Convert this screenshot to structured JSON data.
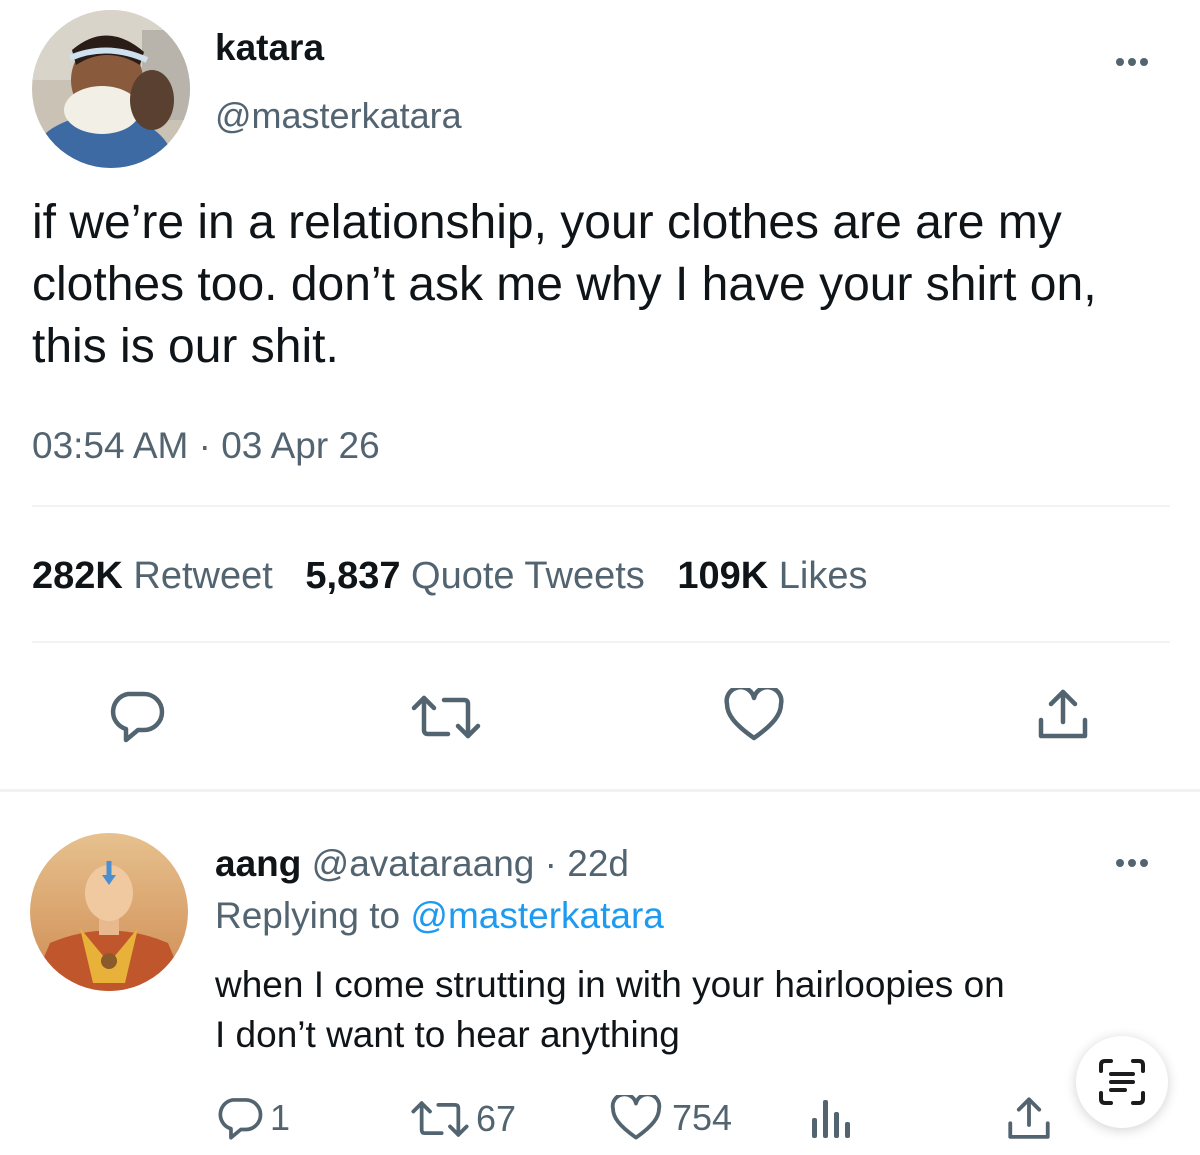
{
  "tweet": {
    "author": {
      "display_name": "katara",
      "handle": "@masterkatara",
      "avatar_icon": "katara-avatar"
    },
    "text": "if we’re in a relationship, your clothes are are my clothes too. don’t ask me why I have your shirt on, this is our shit.",
    "time": "03:54 AM",
    "separator": "·",
    "date": "03 Apr 26",
    "stats": {
      "retweets_count": "282K",
      "retweets_label": "Retweet",
      "quotes_count": "5,837",
      "quotes_label": "Quote Tweets",
      "likes_count": "109K",
      "likes_label": "Likes"
    },
    "actions": [
      "reply-icon",
      "retweet-icon",
      "like-icon",
      "share-icon"
    ]
  },
  "reply": {
    "author": {
      "display_name": "aang",
      "handle": "@avataraang",
      "separator": "·",
      "age": "22d",
      "avatar_icon": "aang-avatar"
    },
    "replying_prefix": "Replying to",
    "replying_handle": "@masterkatara",
    "text_line1": "when I come strutting in with your hairloopies on",
    "text_line2": "I don’t want to hear anything",
    "counts": {
      "replies": "1",
      "retweets": "67",
      "likes": "754"
    }
  },
  "colors": {
    "text": "#0f1419",
    "muted": "#536471",
    "link": "#1d9bf0",
    "divider": "#eff3f4"
  }
}
